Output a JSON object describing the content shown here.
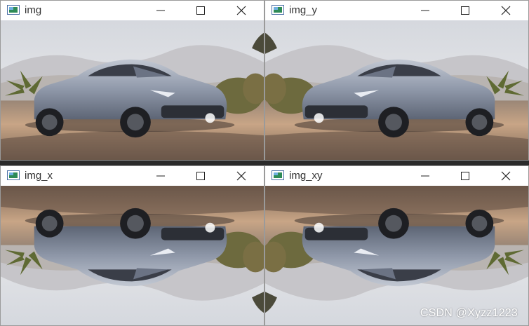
{
  "windows": [
    {
      "title": "img",
      "flip_h": false,
      "flip_v": false
    },
    {
      "title": "img_y",
      "flip_h": true,
      "flip_v": false
    },
    {
      "title": "img_x",
      "flip_h": false,
      "flip_v": true
    },
    {
      "title": "img_xy",
      "flip_h": true,
      "flip_v": true
    }
  ],
  "controls": {
    "minimize_icon": "minimize-icon",
    "maximize_icon": "maximize-icon",
    "close_icon": "close-icon"
  },
  "watermark": "CSDN @Xyzz1223",
  "colors": {
    "titlebar": "#ffffff",
    "car_body": "#9aa3b3",
    "sky": "#d9dde4",
    "ground": "#b48c6a"
  }
}
